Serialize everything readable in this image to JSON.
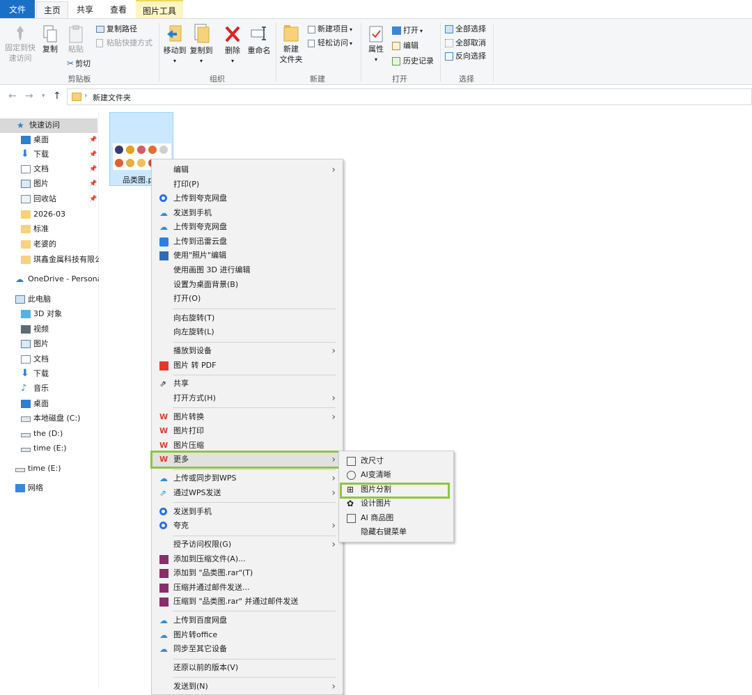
{
  "tabs": {
    "file": "文件",
    "home": "主页",
    "share": "共享",
    "view": "查看",
    "picture_tools": "图片工具"
  },
  "ribbon": {
    "pin_quick_access_line1": "固定到快",
    "pin_quick_access_line2": "速访问",
    "copy": "复制",
    "paste": "粘贴",
    "copy_path": "复制路径",
    "paste_shortcut": "粘贴快捷方式",
    "cut": "剪切",
    "group_clipboard": "剪贴板",
    "move_to": "移动到",
    "copy_to": "复制到",
    "delete": "删除",
    "rename": "重命名",
    "group_organize": "组织",
    "new_folder_line1": "新建",
    "new_folder_line2": "文件夹",
    "new_item": "新建项目",
    "easy_access": "轻松访问",
    "group_new": "新建",
    "properties": "属性",
    "open": "打开",
    "edit": "编辑",
    "history": "历史记录",
    "group_open": "打开",
    "select_all": "全部选择",
    "select_none": "全部取消",
    "invert_selection": "反向选择",
    "group_select": "选择"
  },
  "address": {
    "breadcrumb": "新建文件夹"
  },
  "nav": {
    "quick_access": "快速访问",
    "desktop": "桌面",
    "downloads": "下载",
    "documents": "文档",
    "pictures": "图片",
    "recycle": "回收站",
    "f1": "2026-03",
    "f2": "标准",
    "f3": "老婆的",
    "f4": "琪鑫金属科技有限公",
    "onedrive": "OneDrive - Personal",
    "this_pc": "此电脑",
    "objects3d": "3D 对象",
    "videos": "视频",
    "pc_pictures": "图片",
    "pc_documents": "文档",
    "pc_downloads": "下载",
    "music": "音乐",
    "pc_desktop": "桌面",
    "drive_c": "本地磁盘 (C:)",
    "drive_d": "the (D:)",
    "drive_e": "time (E:)",
    "drive_e2": "time (E:)",
    "network": "网络"
  },
  "file": {
    "name": "品类图.p"
  },
  "menu": {
    "edit": "编辑",
    "print": "打印(P)",
    "upload_kuake": "上传到夸克网盘",
    "send_phone": "发送到手机",
    "upload_kuake2": "上传到夸克网盘",
    "upload_xunlei": "上传到迅雷云盘",
    "edit_photos": "使用\"照片\"编辑",
    "edit_paint3d": "使用画图 3D 进行编辑",
    "set_wallpaper": "设置为桌面背景(B)",
    "open": "打开(O)",
    "rotate_right": "向右旋转(T)",
    "rotate_left": "向左旋转(L)",
    "cast": "播放到设备",
    "to_pdf": "图片 转 PDF",
    "share": "共享",
    "open_with": "打开方式(H)",
    "img_convert": "图片转换",
    "img_print": "图片打印",
    "img_compress": "图片压缩",
    "more": "更多",
    "wps_sync": "上传或同步到WPS",
    "wps_send": "通过WPS发送",
    "send_phone2": "发送到手机",
    "kuake": "夸克",
    "grant_access": "授予访问权限(G)",
    "add_archive": "添加到压缩文件(A)...",
    "add_rar": "添加到 \"品类图.rar\"(T)",
    "compress_email": "压缩并通过邮件发送...",
    "compress_rar_email": "压缩到 \"品类图.rar\" 并通过邮件发送",
    "baidu": "上传到百度网盘",
    "to_office": "图片转office",
    "sync_devices": "同步至其它设备",
    "restore": "还原以前的版本(V)",
    "send_to": "发送到(N)"
  },
  "submenu": {
    "resize": "改尺寸",
    "ai_clear": "AI变清晰",
    "split": "图片分割",
    "design": "设计图片",
    "ai_product": "AI 商品图",
    "hide_menu": "隐藏右键菜单"
  },
  "colors": {
    "highlight": "#8cc63f",
    "file_tab": "#1a6fc7",
    "selection": "#cce8ff"
  }
}
